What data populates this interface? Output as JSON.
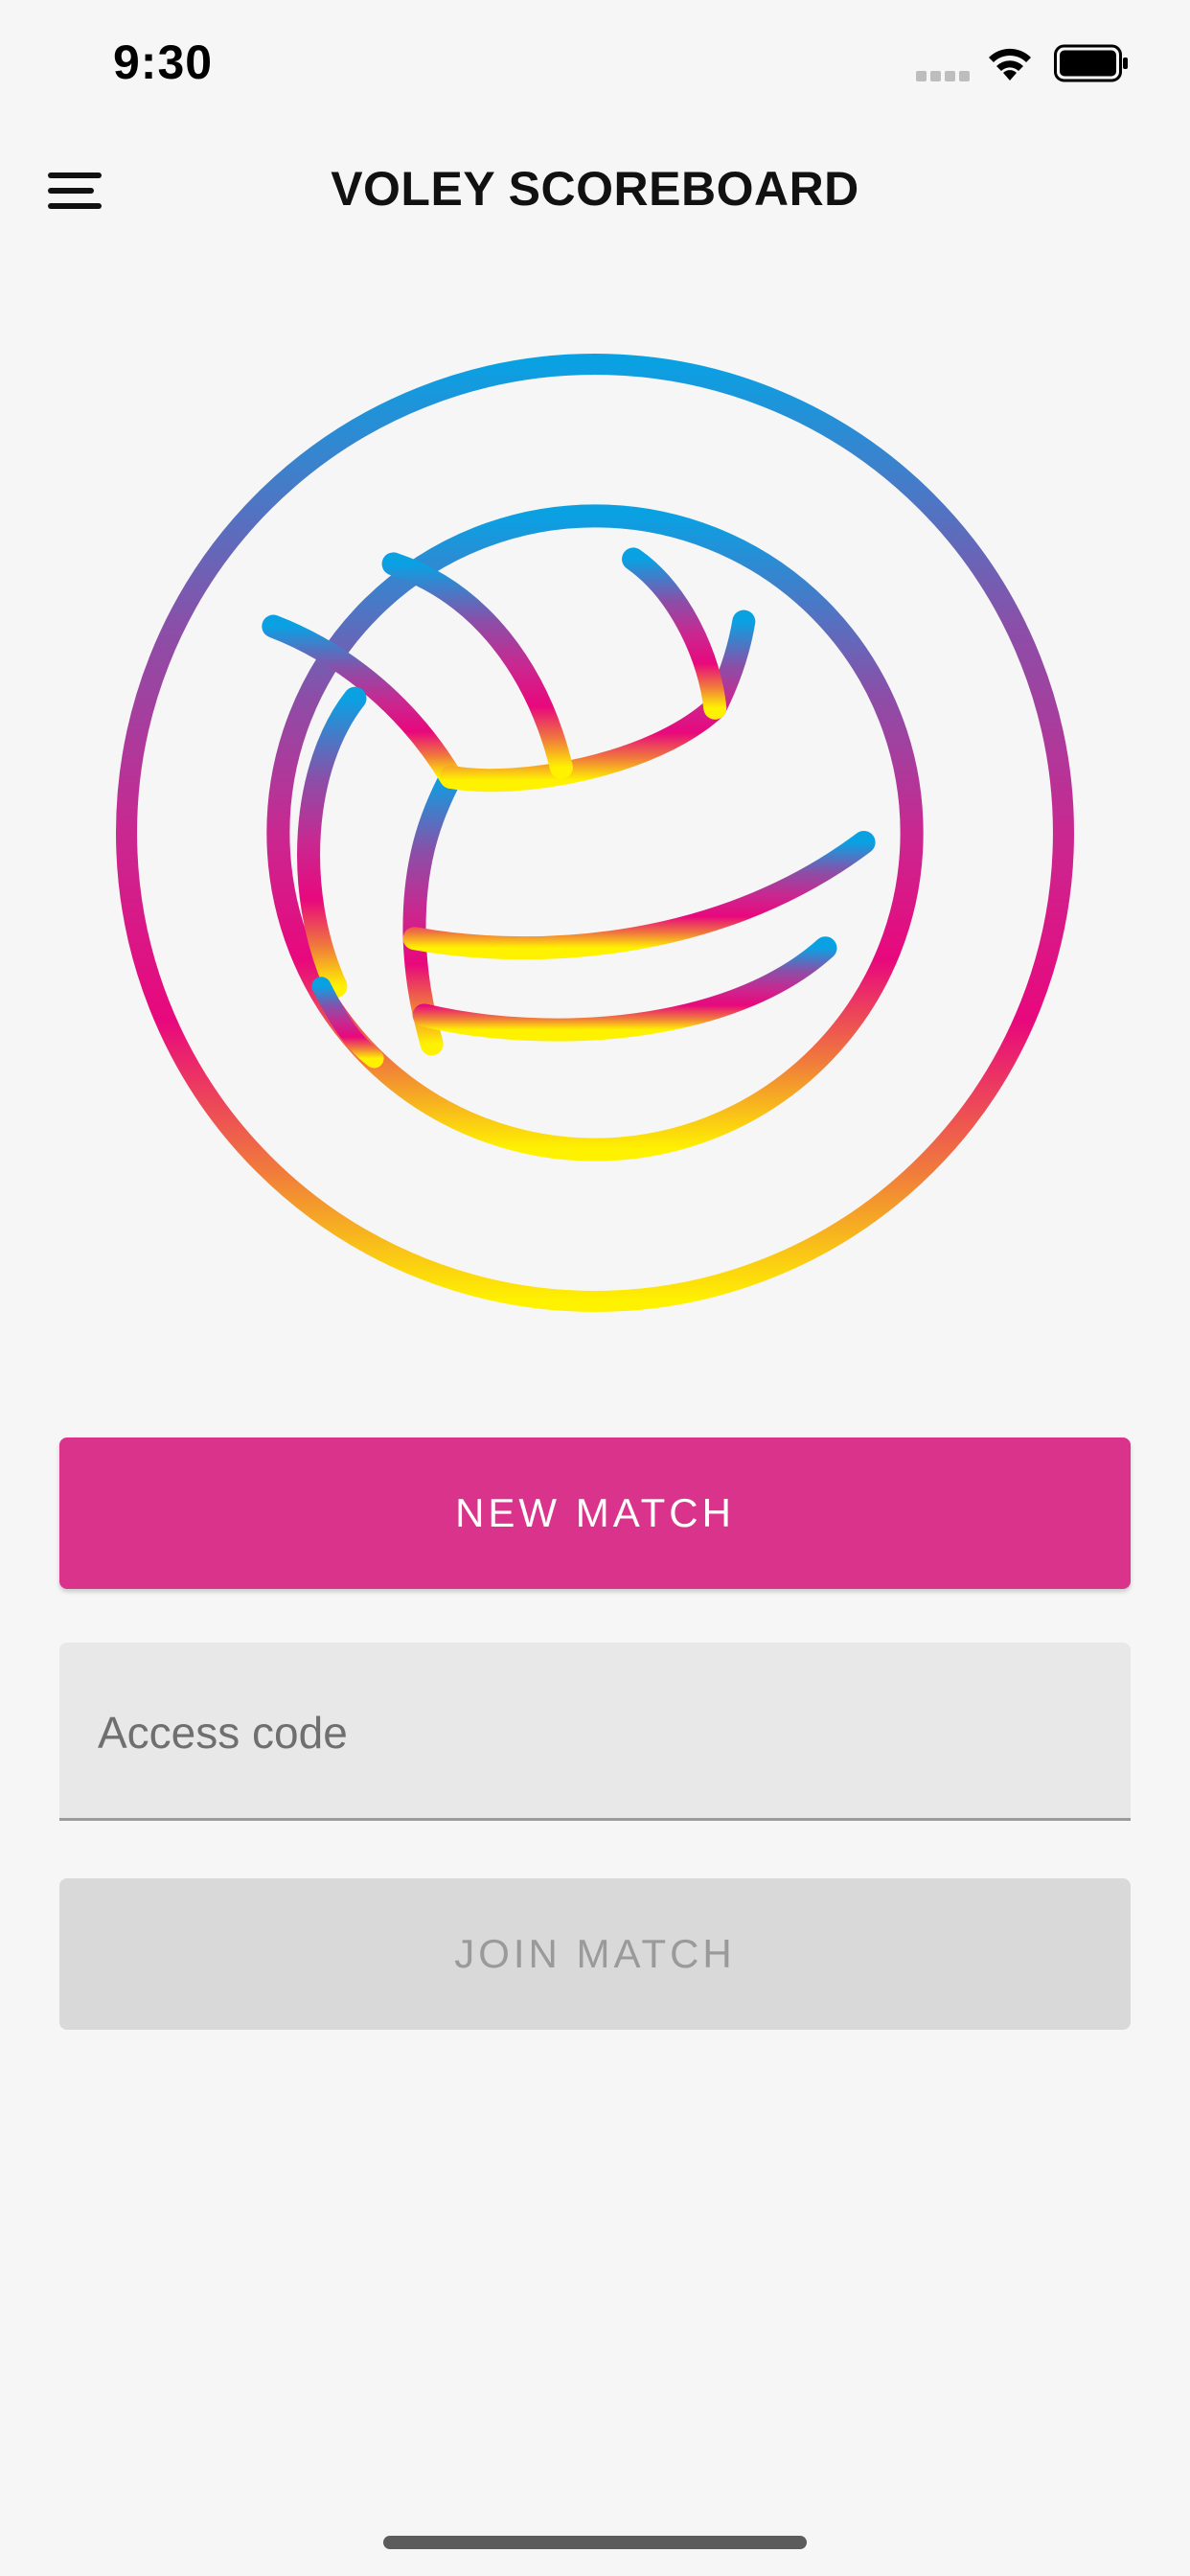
{
  "status_bar": {
    "time": "9:30",
    "signal_icon": "cellular-signal-icon",
    "wifi_icon": "wifi-icon",
    "battery_icon": "battery-icon"
  },
  "header": {
    "menu_icon": "hamburger-menu-icon",
    "title": "VOLEY SCOREBOARD"
  },
  "logo": {
    "icon": "volleyball-icon",
    "gradient_colors": [
      "#0aa1e3",
      "#8a4fa8",
      "#e8087d",
      "#fff200"
    ]
  },
  "actions": {
    "new_match_label": "NEW MATCH",
    "access_code_placeholder": "Access code",
    "access_code_value": "",
    "join_match_label": "JOIN MATCH"
  },
  "colors": {
    "primary": "#d9338b",
    "disabled_bg": "#d9d9d9",
    "disabled_text": "#9a9a9a",
    "background": "#f6f6f6"
  }
}
